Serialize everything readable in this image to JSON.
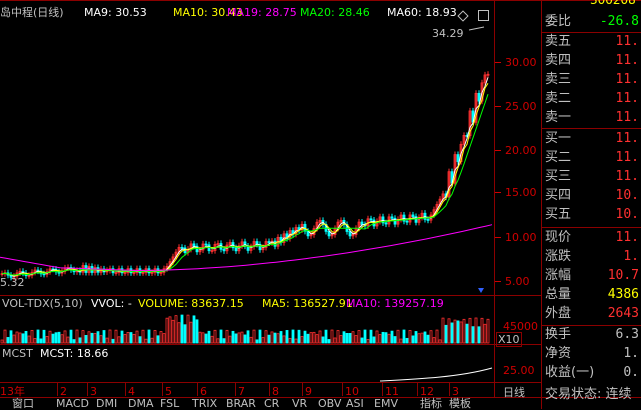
{
  "header": {
    "title": "岛中程(日线)",
    "ma": [
      {
        "label": "MA9: 30.53",
        "color": "#ffffff"
      },
      {
        "label": "MA10: 30.43",
        "color": "#ffff00"
      },
      {
        "label": "MA19: 28.75",
        "color": "#ff00ff"
      },
      {
        "label": "MA20: 28.46",
        "color": "#00ff00"
      },
      {
        "label": "MA60: 18.93",
        "color": "#ffffff"
      }
    ],
    "top_right_code": "300208",
    "icon": "settings-square-icon"
  },
  "price_chart": {
    "high_annotation": "34.29",
    "low_annotation": "5.32",
    "y_ticks": [
      "30.00",
      "25.00",
      "20.00",
      "15.00",
      "10.00",
      "5.00"
    ]
  },
  "volume_panel": {
    "labels": [
      {
        "text": "VOL-TDX(5,10)",
        "color": "#c0c0c0"
      },
      {
        "text": "VVOL: -",
        "color": "#ffffff"
      },
      {
        "text": "VOLUME: 83637.15",
        "color": "#ffff00"
      },
      {
        "text": "MA5: 136527.91",
        "color": "#ffff00"
      },
      {
        "text": "MA10: 139257.19",
        "color": "#ff00ff"
      }
    ],
    "y_tick": "45000",
    "unit": "X10"
  },
  "mcst_panel": {
    "labels": [
      {
        "text": "MCST",
        "color": "#c0c0c0"
      },
      {
        "text": "MCST: 18.66",
        "color": "#ffffff"
      }
    ],
    "y_tick": "25.00"
  },
  "time_axis": {
    "labels": [
      "13年",
      "2",
      "3",
      "4",
      "5",
      "6",
      "7",
      "8",
      "9",
      "10",
      "11",
      "12",
      "3"
    ],
    "period": "日线"
  },
  "bottom_tabs": [
    "窗口",
    "MACD",
    "DMI",
    "DMA",
    "FSL",
    "TRIX",
    "BRAR",
    "CR",
    "VR",
    "OBV",
    "ASI",
    "EMV",
    "指标",
    "模板"
  ],
  "sidebar": {
    "rows": [
      {
        "k": "委比",
        "v": "-26.8",
        "color": "#00ff00"
      },
      {
        "k": "卖五",
        "v": "11.",
        "color": "#ff3030"
      },
      {
        "k": "卖四",
        "v": "11.",
        "color": "#ff3030"
      },
      {
        "k": "卖三",
        "v": "11.",
        "color": "#ff3030"
      },
      {
        "k": "卖二",
        "v": "11.",
        "color": "#ff3030"
      },
      {
        "k": "卖一",
        "v": "11.",
        "color": "#ff3030"
      },
      {
        "k": "买一",
        "v": "11.",
        "color": "#ff3030"
      },
      {
        "k": "买二",
        "v": "11.",
        "color": "#ff3030"
      },
      {
        "k": "买三",
        "v": "11.",
        "color": "#ff3030"
      },
      {
        "k": "买四",
        "v": "10.",
        "color": "#ff3030"
      },
      {
        "k": "买五",
        "v": "10.",
        "color": "#ff3030"
      },
      {
        "k": "现价",
        "v": "11.",
        "color": "#ff3030"
      },
      {
        "k": "涨跌",
        "v": "1.",
        "color": "#ff3030"
      },
      {
        "k": "涨幅",
        "v": "10.7",
        "color": "#ff3030"
      },
      {
        "k": "总量",
        "v": "4386",
        "color": "#ffff00"
      },
      {
        "k": "外盘",
        "v": "2643",
        "color": "#ff3030"
      },
      {
        "k": "换手",
        "v": "6.3",
        "color": "#c0c0c0"
      },
      {
        "k": "净资",
        "v": "1.",
        "color": "#c0c0c0"
      },
      {
        "k": "收益(一)",
        "v": "0.",
        "color": "#c0c0c0"
      }
    ],
    "status": "交易状态: 连续"
  },
  "colors": {
    "up": "#ff3030",
    "down": "#00ffff",
    "grid": "#8b0000",
    "ma5": "#ffffff",
    "ma10": "#ffff00",
    "ma20": "#00ff00",
    "ma60": "#ff00ff"
  }
}
